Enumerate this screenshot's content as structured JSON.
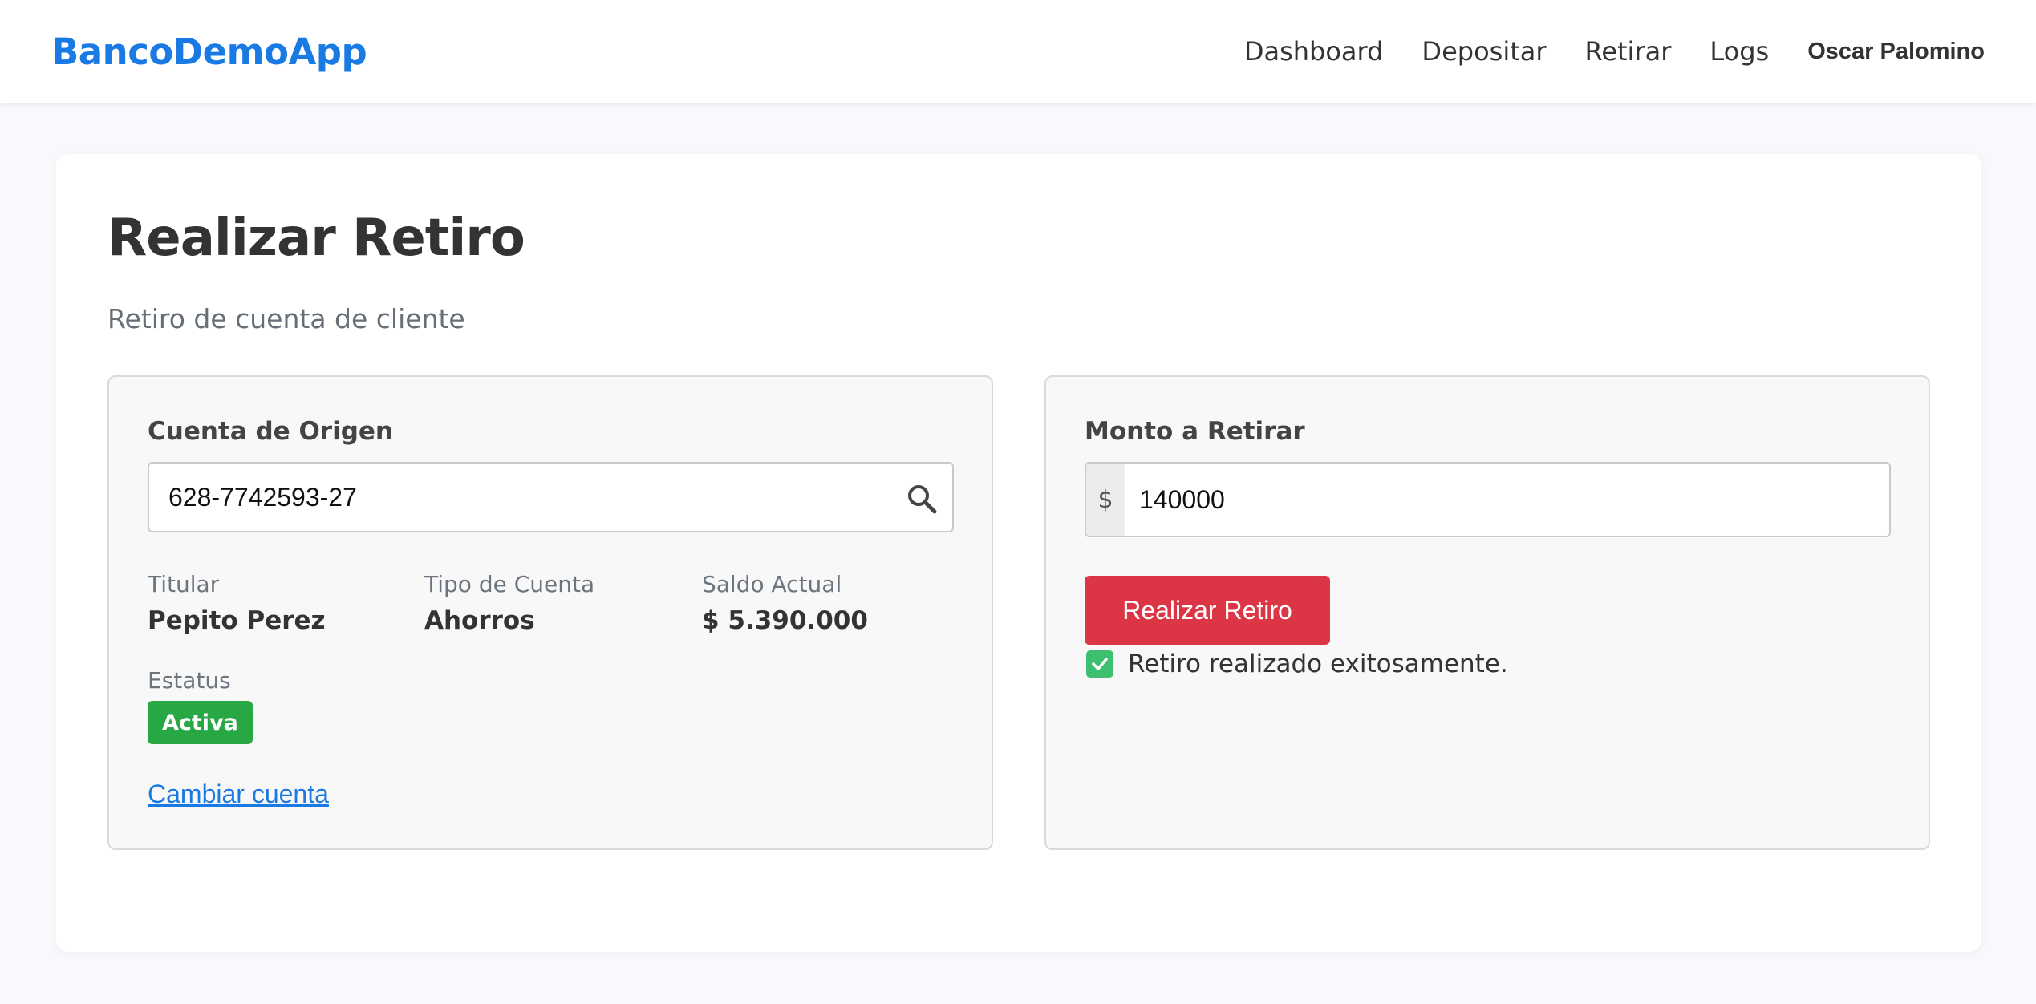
{
  "navbar": {
    "brand": "BancoDemoApp",
    "links": [
      "Dashboard",
      "Depositar",
      "Retirar",
      "Logs"
    ],
    "user_name": "Oscar Palomino"
  },
  "page": {
    "title": "Realizar Retiro",
    "subtitle": "Retiro de cuenta de cliente"
  },
  "origin_panel": {
    "label": "Cuenta de Origen",
    "account_number": "628-7742593-27",
    "search_icon": "search-icon",
    "fields": {
      "holder_label": "Titular",
      "holder_value": "Pepito Perez",
      "type_label": "Tipo de Cuenta",
      "type_value": "Ahorros",
      "balance_label": "Saldo Actual",
      "balance_value": "$ 5.390.000",
      "status_label": "Estatus",
      "status_value": "Activa"
    },
    "change_link": "Cambiar cuenta"
  },
  "amount_panel": {
    "label": "Monto a Retirar",
    "currency_symbol": "$",
    "amount_value": "140000",
    "submit_label": "Realizar Retiro",
    "success_message": "Retiro realizado exitosamente.",
    "success_icon": "check-icon"
  },
  "colors": {
    "brand": "#1a7ae3",
    "danger": "#dc3545",
    "success": "#28a745",
    "link": "#1a7ae3"
  }
}
